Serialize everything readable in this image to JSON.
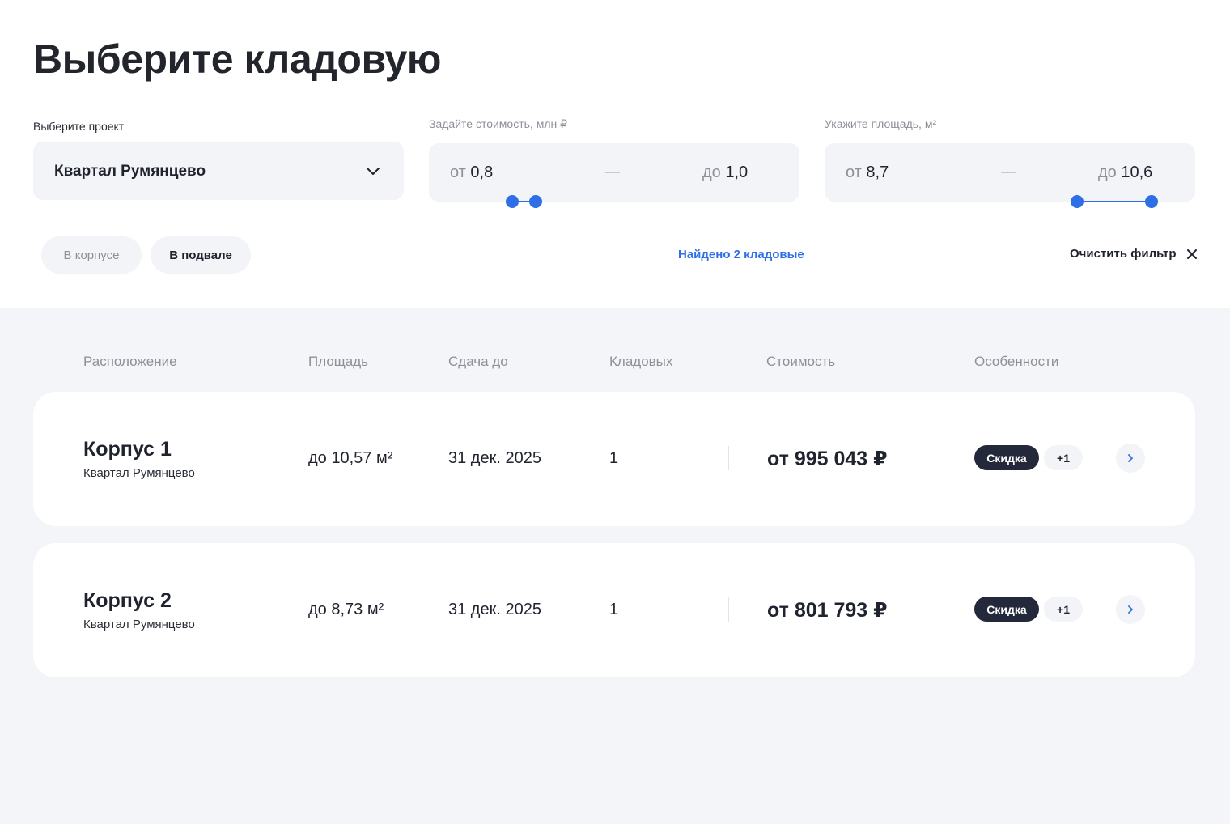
{
  "page": {
    "title": "Выберите кладовую"
  },
  "filters": {
    "project": {
      "label": "Выберите проект",
      "value": "Квартал Румянцево"
    },
    "price": {
      "label": "Задайте стоимость, млн ₽",
      "from_prefix": "от",
      "from": "0,8",
      "to_prefix": "до",
      "to": "1,0"
    },
    "area": {
      "label": "Укажите площадь, м²",
      "from_prefix": "от",
      "from": "8,7",
      "to_prefix": "до",
      "to": "10,6"
    },
    "chips": [
      {
        "label": "В корпусе",
        "active": false
      },
      {
        "label": "В подвале",
        "active": true
      }
    ],
    "found": "Найдено 2 кладовые",
    "clear": "Очистить фильтр"
  },
  "table": {
    "headers": [
      "Расположение",
      "Площадь",
      "Сдача до",
      "Кладовых",
      "Стоимость",
      "Особенности"
    ],
    "rows": [
      {
        "title": "Корпус 1",
        "subtitle": "Квартал Румянцево",
        "area": "до 10,57 м²",
        "delivery": "31 дек. 2025",
        "count": "1",
        "price": "от 995 043 ₽",
        "badge": "Скидка",
        "more": "+1"
      },
      {
        "title": "Корпус 2",
        "subtitle": "Квартал Румянцево",
        "area": "до 8,73 м²",
        "delivery": "31 дек. 2025",
        "count": "1",
        "price": "от 801 793 ₽",
        "badge": "Скидка",
        "more": "+1"
      }
    ]
  },
  "colors": {
    "accent": "#2f6fe6",
    "badge_bg": "#23283a",
    "panel_bg": "#f3f4f8",
    "results_bg": "#f4f5f9"
  },
  "icons": {
    "select": "chevron-down-icon",
    "clear": "close-icon",
    "row_open": "chevron-right-icon"
  }
}
